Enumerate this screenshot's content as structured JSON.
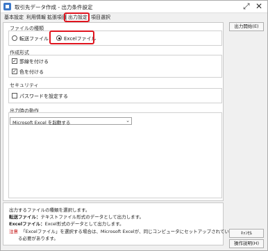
{
  "window": {
    "title": "取引先データ作成 - 出力条件設定",
    "expand_glyph": "⤢",
    "close_glyph": "✕"
  },
  "tabs": [
    {
      "label": "基本設定"
    },
    {
      "label": "利用情報"
    },
    {
      "label": "拡張項目"
    },
    {
      "label": "出力設定"
    },
    {
      "label": "項目選択"
    }
  ],
  "file_type": {
    "heading": "ファイルの種類",
    "options": [
      {
        "label": "転送ファイル",
        "selected": false
      },
      {
        "label": "Excelファイル",
        "selected": true
      }
    ]
  },
  "format": {
    "heading": "作成形式",
    "options": [
      {
        "label": "罫線を付ける",
        "checked": true
      },
      {
        "label": "色を付ける",
        "checked": true
      }
    ]
  },
  "security": {
    "heading": "セキュリティ",
    "options": [
      {
        "label": "パスワードを設定する",
        "checked": false
      }
    ]
  },
  "output_action": {
    "heading": "出力時の動作",
    "selected": "Microsoft Excel を起動する"
  },
  "buttons": {
    "start": "出力開始(E)",
    "cancel": "ｷｬﾝｾﾙ",
    "help": "操作説明(H)"
  },
  "description": {
    "line1": "出力するファイルの種類を選択します。",
    "line2_label": "転送ファイル：",
    "line2_text": "テキストファイル形式のデータとして出力します。",
    "line3_label": "Excelファイル：",
    "line3_text": "Excel形式のデータとして出力します。",
    "note_label": "注意",
    "note_text1": "「Excelファイル」を選択する場合は、Microsoft Excelが、同じコンピュータにセットアップされてい",
    "note_text2": "る必要があります。"
  },
  "colors": {
    "highlight": "#e0141e",
    "note": "#c00000"
  }
}
